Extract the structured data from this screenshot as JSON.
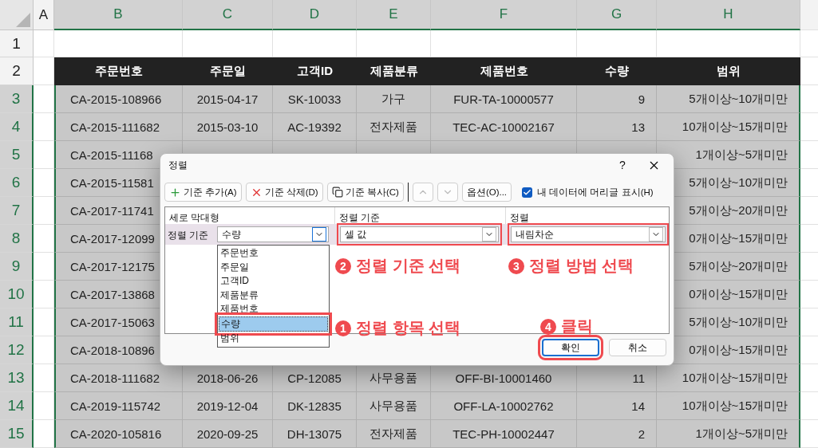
{
  "columns": [
    {
      "label": "A",
      "selected": false
    },
    {
      "label": "B",
      "selected": true
    },
    {
      "label": "C",
      "selected": true
    },
    {
      "label": "D",
      "selected": true
    },
    {
      "label": "E",
      "selected": true
    },
    {
      "label": "F",
      "selected": true
    },
    {
      "label": "G",
      "selected": true
    },
    {
      "label": "H",
      "selected": true
    }
  ],
  "rows": [
    {
      "number": "1",
      "selected": false,
      "kind": "blank",
      "cells": []
    },
    {
      "number": "2",
      "selected": false,
      "kind": "header",
      "cells": [
        "주문번호",
        "주문일",
        "고객ID",
        "제품분류",
        "제품번호",
        "수량",
        "범위"
      ]
    },
    {
      "number": "3",
      "selected": true,
      "kind": "data",
      "cells": [
        "CA-2015-108966",
        "2015-04-17",
        "SK-10033",
        "가구",
        "FUR-TA-10000577",
        "9",
        "5개이상~10개미만"
      ]
    },
    {
      "number": "4",
      "selected": true,
      "kind": "data",
      "cells": [
        "CA-2015-111682",
        "2015-03-10",
        "AC-19392",
        "전자제품",
        "TEC-AC-10002167",
        "13",
        "10개이상~15개미만"
      ]
    },
    {
      "number": "5",
      "selected": true,
      "kind": "data",
      "cells": [
        "CA-2015-11168",
        null,
        null,
        null,
        null,
        null,
        "1개이상~5개미만"
      ]
    },
    {
      "number": "6",
      "selected": true,
      "kind": "data",
      "cells": [
        "CA-2015-11581",
        null,
        null,
        null,
        null,
        null,
        "5개이상~10개미만"
      ]
    },
    {
      "number": "7",
      "selected": true,
      "kind": "data",
      "cells": [
        "CA-2017-11741",
        null,
        null,
        null,
        null,
        null,
        "5개이상~20개미만"
      ]
    },
    {
      "number": "8",
      "selected": true,
      "kind": "data",
      "cells": [
        "CA-2017-12099",
        null,
        null,
        null,
        null,
        null,
        "0개이상~15개미만"
      ]
    },
    {
      "number": "9",
      "selected": true,
      "kind": "data",
      "cells": [
        "CA-2017-12175",
        null,
        null,
        null,
        null,
        null,
        "5개이상~20개미만"
      ]
    },
    {
      "number": "10",
      "selected": true,
      "kind": "data",
      "cells": [
        "CA-2017-13868",
        null,
        null,
        null,
        null,
        null,
        "0개이상~15개미만"
      ]
    },
    {
      "number": "11",
      "selected": true,
      "kind": "data",
      "cells": [
        "CA-2017-15063",
        null,
        null,
        null,
        null,
        null,
        "5개이상~10개미만"
      ]
    },
    {
      "number": "12",
      "selected": true,
      "kind": "data",
      "cells": [
        "CA-2018-10896",
        null,
        null,
        null,
        null,
        null,
        "0개이상~15개미만"
      ]
    },
    {
      "number": "13",
      "selected": true,
      "kind": "data",
      "cells": [
        "CA-2018-111682",
        "2018-06-26",
        "CP-12085",
        "사무용품",
        "OFF-BI-10001460",
        "11",
        "10개이상~15개미만"
      ]
    },
    {
      "number": "14",
      "selected": true,
      "kind": "data",
      "cells": [
        "CA-2019-115742",
        "2019-12-04",
        "DK-12835",
        "사무용품",
        "OFF-LA-10002762",
        "14",
        "10개이상~15개미만"
      ]
    },
    {
      "number": "15",
      "selected": true,
      "kind": "data",
      "cells": [
        "CA-2020-105816",
        "2020-09-25",
        "DH-13075",
        "전자제품",
        "TEC-PH-10002447",
        "2",
        "1개이상~5개미만"
      ]
    }
  ],
  "dialog": {
    "title": "정렬",
    "help": "?",
    "toolbar": [
      {
        "kind": "add",
        "label": "기준 추가(A)",
        "disabled": false
      },
      {
        "kind": "delete",
        "label": "기준 삭제(D)",
        "disabled": false
      },
      {
        "kind": "copy",
        "label": "기준 복사(C)",
        "disabled": false
      },
      {
        "kind": "up",
        "disabled": true
      },
      {
        "kind": "down",
        "disabled": true
      },
      {
        "kind": "options",
        "label": "옵션(O)...",
        "disabled": false
      }
    ],
    "header_option": {
      "label": "내 데이터에 머리글 표시(H)",
      "checked": true
    },
    "grid": {
      "columns": [
        "세로 막대형",
        "정렬 기준",
        "정렬"
      ],
      "level_label": "정렬 기준",
      "column_field": {
        "value": "수량",
        "expanded": true,
        "options": [
          {
            "label": "주문번호",
            "selected": false,
            "highlighted": false
          },
          {
            "label": "주문일",
            "selected": false,
            "highlighted": false
          },
          {
            "label": "고객ID",
            "selected": false,
            "highlighted": false
          },
          {
            "label": "제품분류",
            "selected": false,
            "highlighted": false
          },
          {
            "label": "제품번호",
            "selected": false,
            "highlighted": false
          },
          {
            "label": "수량",
            "selected": true,
            "highlighted": true
          },
          {
            "label": "범위",
            "selected": false,
            "highlighted": false
          }
        ]
      },
      "sort_on": {
        "value": "셀 값",
        "highlighted": true
      },
      "order": {
        "value": "내림차순",
        "highlighted": true
      }
    },
    "annotations": [
      {
        "number": "2",
        "text": "정렬 기준 선택"
      },
      {
        "number": "3",
        "text": "정렬 방법 선택"
      },
      {
        "number": "1",
        "text": "정렬 항목 선택"
      },
      {
        "number": "4",
        "text": "클릭"
      }
    ],
    "buttons": [
      {
        "label": "확인",
        "default": true,
        "highlighted": true
      },
      {
        "label": "취소",
        "default": false,
        "highlighted": false
      }
    ]
  }
}
